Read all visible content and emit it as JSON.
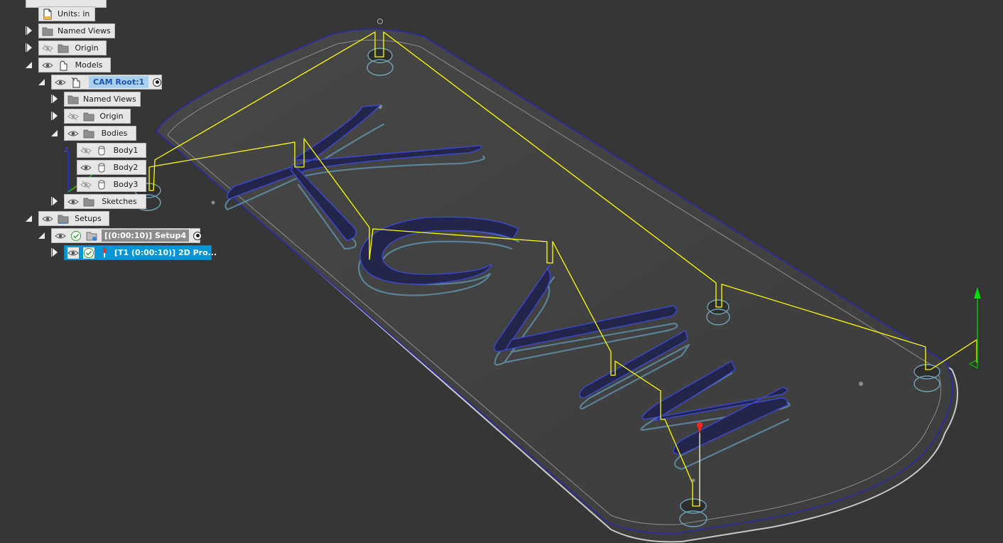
{
  "browser": {
    "units": "Units: in",
    "named_views": "Named Views",
    "origin": "Origin",
    "models": "Models",
    "cam_root": "CAM Root:1",
    "named_views_2": "Named Views",
    "origin_2": "Origin",
    "bodies": "Bodies",
    "body1": "Body1",
    "body2": "Body2",
    "body3": "Body3",
    "sketches": "Sketches",
    "setups": "Setups",
    "setup4": "[(0:00:10)] Setup4",
    "operation": "[T1 (0:00:10)] 2D Pro..."
  },
  "icons": {
    "eye": "eye-icon",
    "eye_hidden": "eye-hidden-icon",
    "folder": "folder-icon",
    "document": "document-icon",
    "component": "component-icon",
    "body": "body-icon",
    "check": "check-icon",
    "tool": "tool-icon",
    "setup": "setup-icon"
  },
  "colors": {
    "viewport_bg": "#363636",
    "selection": "#0696d7",
    "toolpath": "#ffff00",
    "outline": "#2a2aa8",
    "axis_x": "#ff0000",
    "axis_y": "#00cc00",
    "axis_z": "#0000ff"
  }
}
